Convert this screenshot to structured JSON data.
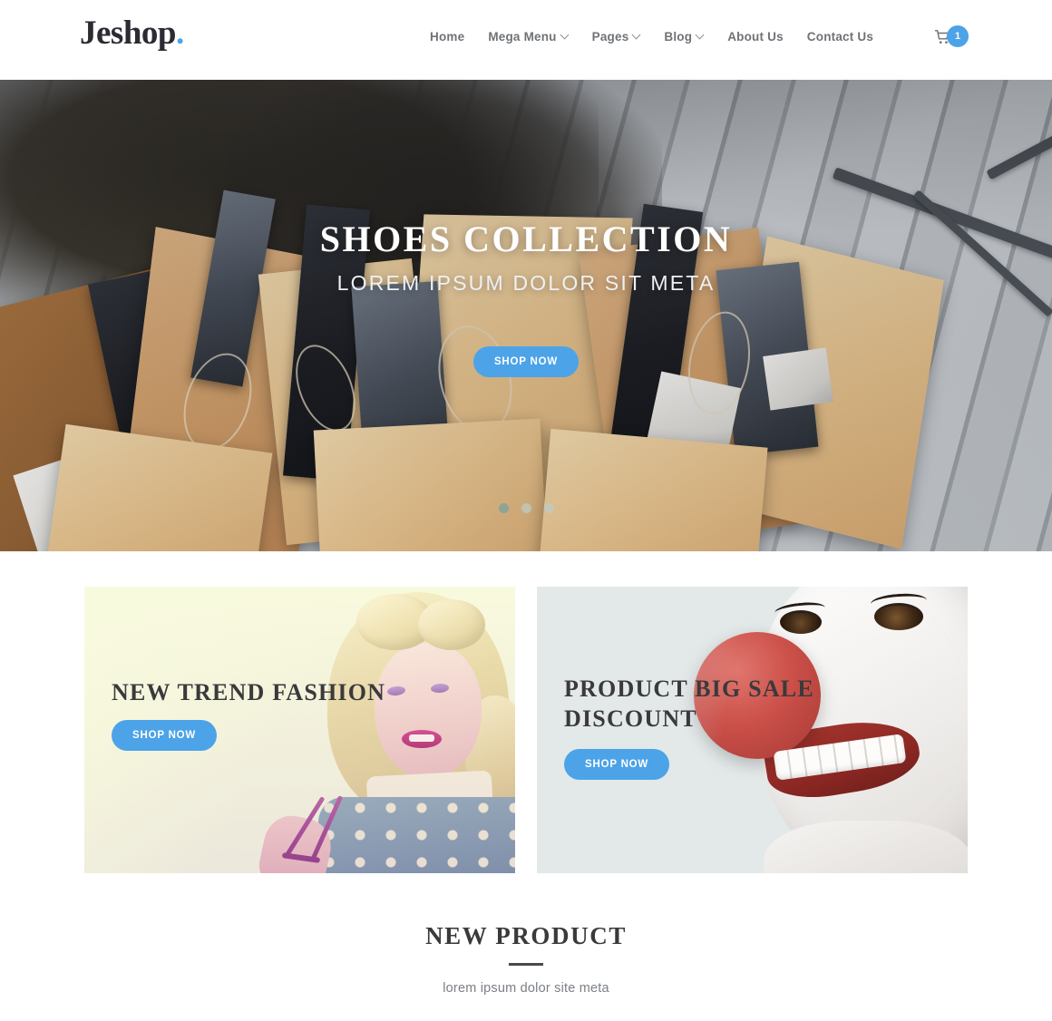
{
  "colors": {
    "accent": "#4ca3e8",
    "heading": "#3a3a3c",
    "nav_text": "#6f7276",
    "promo_left_bg": "#f6f9df",
    "promo_right_bg": "#e3e8e9"
  },
  "header": {
    "logo_text": "Jeshop",
    "logo_dot": ".",
    "nav": [
      {
        "label": "Home",
        "has_caret": false
      },
      {
        "label": "Mega Menu",
        "has_caret": true
      },
      {
        "label": "Pages",
        "has_caret": true
      },
      {
        "label": "Blog",
        "has_caret": true
      },
      {
        "label": "About Us",
        "has_caret": false
      },
      {
        "label": "Contact Us",
        "has_caret": false
      }
    ],
    "cart": {
      "icon": "shopping-cart-icon",
      "badge_count": "1"
    }
  },
  "hero": {
    "title": "SHOES COLLECTION",
    "subtitle": "LOREM IPSUM DOLOR SIT META",
    "button_label": "SHOP NOW",
    "slides": [
      {
        "active": true
      },
      {
        "active": false
      },
      {
        "active": false
      }
    ]
  },
  "promos": [
    {
      "title": "NEW TREND FASHION",
      "button_label": "SHOP NOW",
      "bg": "#f6f9df"
    },
    {
      "title": "PRODUCT BIG SALE\nDISCOUNT",
      "button_label": "SHOP NOW",
      "bg": "#e3e8e9"
    }
  ],
  "new_product": {
    "title": "NEW PRODUCT",
    "subtitle": "lorem ipsum dolor site meta"
  }
}
